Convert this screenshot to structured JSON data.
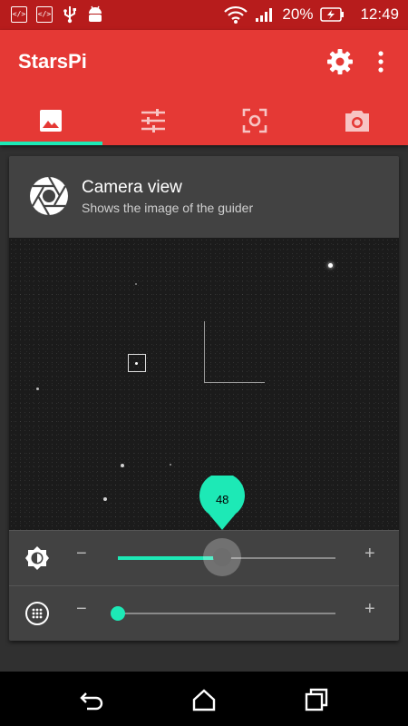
{
  "status_bar": {
    "left_icons": [
      "code-icon",
      "code-icon",
      "usb-icon",
      "android-icon"
    ],
    "left_labels": [
      "</>",
      "</>"
    ],
    "battery_percent": "20%",
    "time": "12:49"
  },
  "app": {
    "title": "StarsPi",
    "accent": "#1DE9B6",
    "primary": "#E53935",
    "primary_dark": "#B71C1C"
  },
  "tabs": [
    {
      "icon": "image-icon",
      "selected": true
    },
    {
      "icon": "tune-icon",
      "selected": false
    },
    {
      "icon": "focus-icon",
      "selected": false
    },
    {
      "icon": "camera-icon",
      "selected": false
    }
  ],
  "card": {
    "icon": "shutter-icon",
    "title": "Camera view",
    "subtitle": "Shows the image of the guider"
  },
  "brightness_slider": {
    "value": 48,
    "fraction": 0.48,
    "minus_label": "−",
    "plus_label": "+"
  },
  "zoom_slider": {
    "fraction": 0.0,
    "minus_label": "−",
    "plus_label": "+"
  }
}
